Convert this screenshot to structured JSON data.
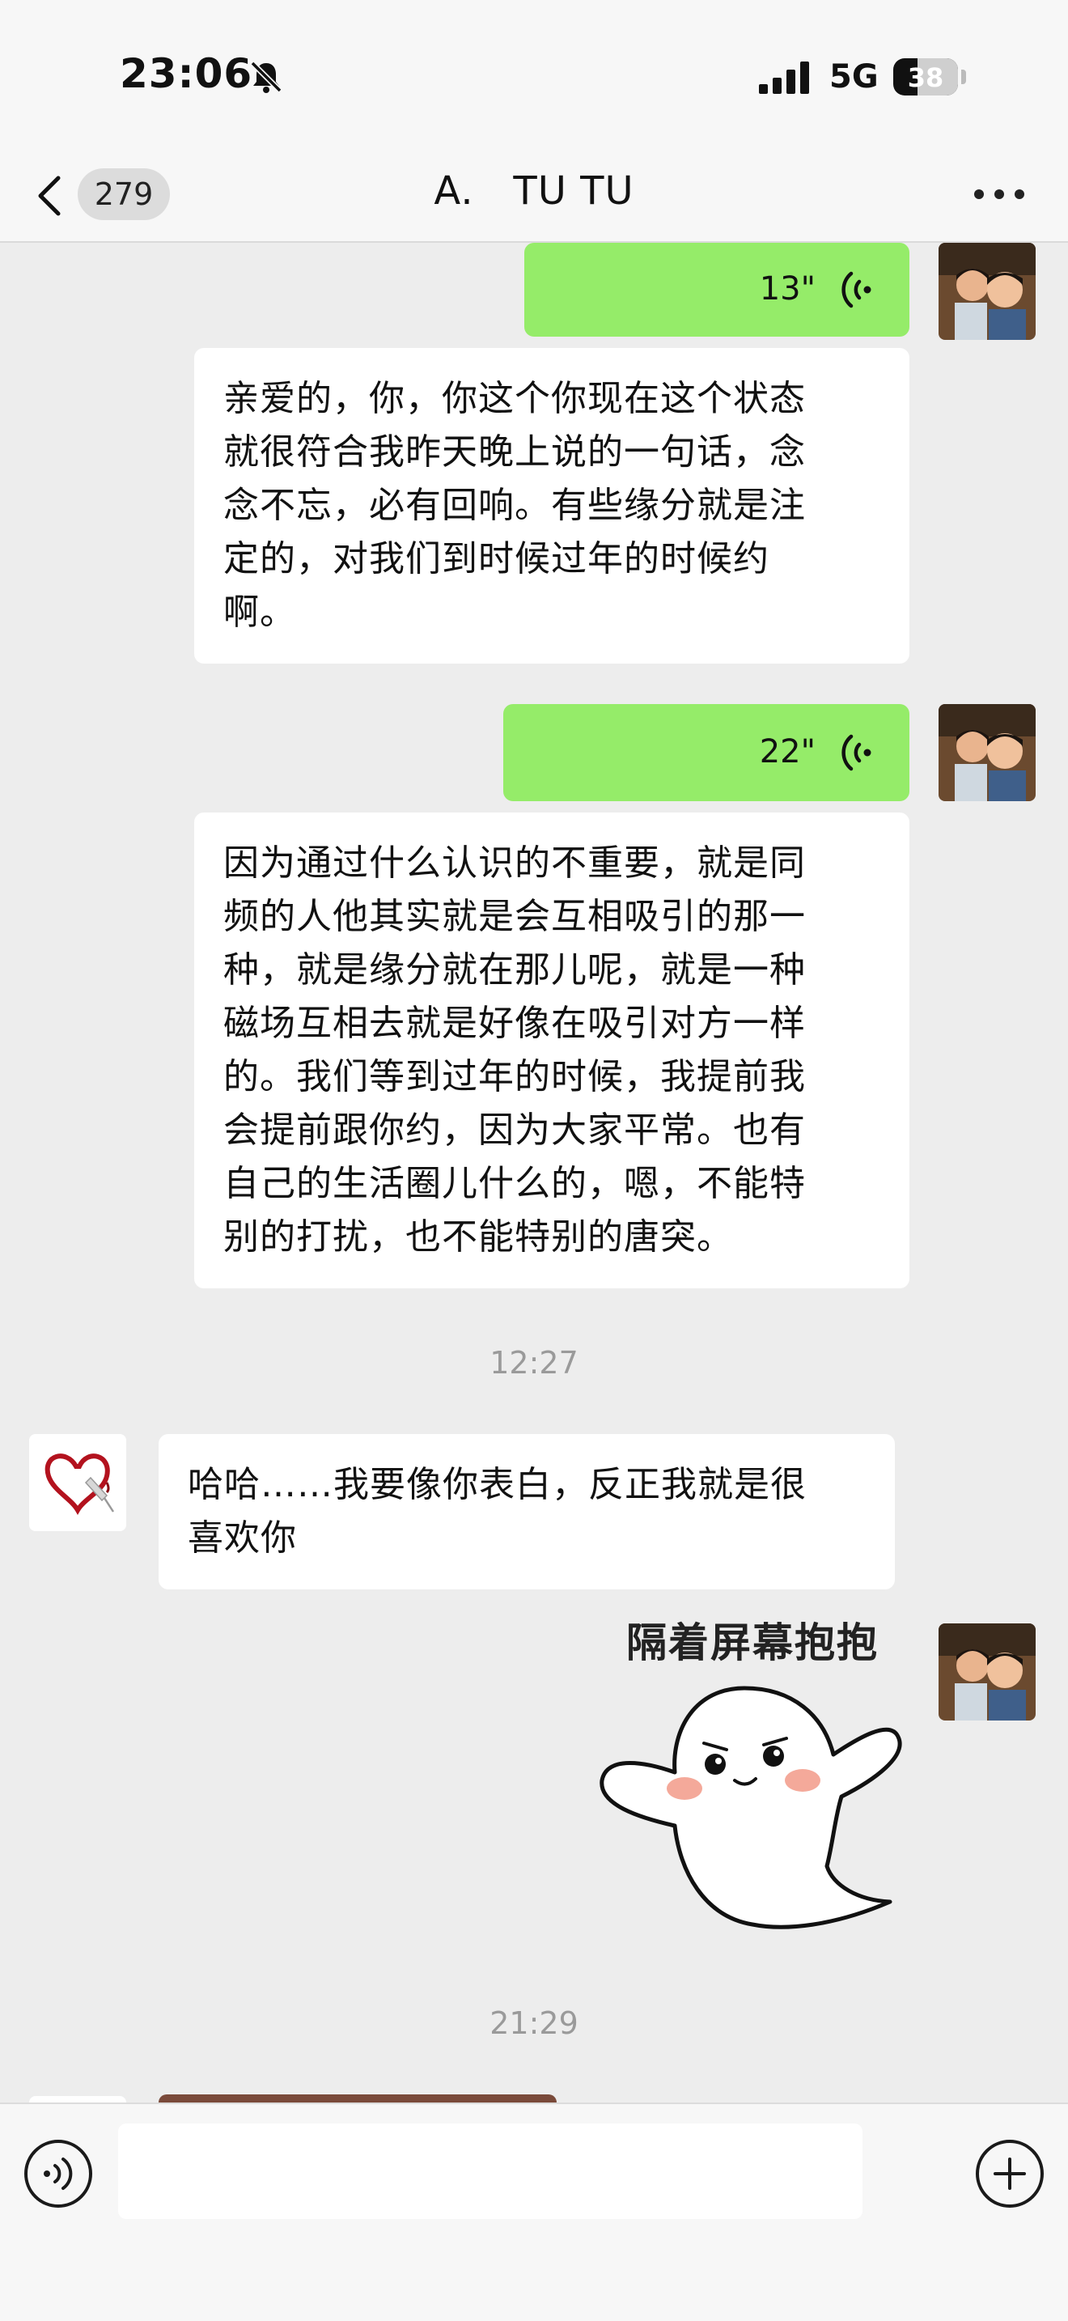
{
  "status_bar": {
    "time": "23:06",
    "network": "5G",
    "battery": "38",
    "battery_level": 0.38,
    "icons": [
      "bell-muted-icon",
      "signal-icon"
    ]
  },
  "nav": {
    "unread_count": "279",
    "title": "A.   TU TU",
    "icons": [
      "chevron-left-icon",
      "more-icon"
    ]
  },
  "messages": [
    {
      "type": "voice",
      "side": "out",
      "duration": "13\""
    },
    {
      "type": "text",
      "side": "in",
      "lines": [
        "亲爱的，你，你这个你现在这个状态",
        "就很符合我昨天晚上说的一句话，念",
        "念不忘，必有回响。有些缘分就是注",
        "定的，对我们到时候过年的时候约",
        "啊。"
      ]
    },
    {
      "type": "voice",
      "side": "out",
      "duration": "22\""
    },
    {
      "type": "text",
      "side": "in",
      "lines": [
        "因为通过什么认识的不重要，就是同",
        "频的人他其实就是会互相吸引的那一",
        "种，就是缘分就在那儿呢，就是一种",
        "磁场互相去就是好像在吸引对方一样",
        "的。我们等到过年的时候，我提前我",
        "会提前跟你约，因为大家平常。也有",
        "自己的生活圈儿什么的，嗯，不能特",
        "别的打扰，也不能特别的唐突。"
      ]
    },
    {
      "type": "time",
      "text": "12:27"
    },
    {
      "type": "text",
      "side": "other",
      "lines": [
        "哈哈……我要像你表白，反正我就是很",
        "喜欢你"
      ]
    },
    {
      "type": "sticker",
      "side": "out",
      "caption": "隔着屏幕抱抱"
    },
    {
      "type": "time",
      "text": "21:29"
    }
  ],
  "input_bar": {
    "placeholder": "",
    "icons": [
      "voice-input-icon",
      "add-icon"
    ]
  },
  "colors": {
    "background": "#ededed",
    "outgoing_bubble": "#95ec69",
    "incoming_bubble": "#ffffff"
  }
}
